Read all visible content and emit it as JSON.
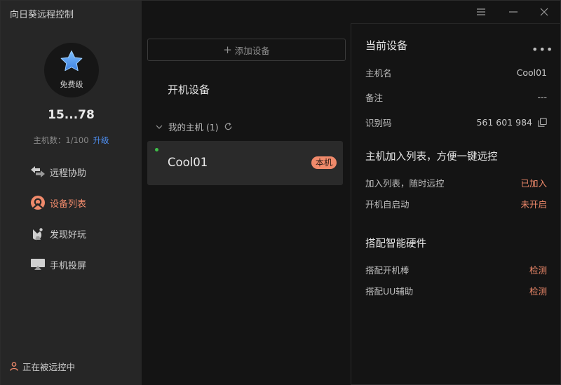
{
  "app": {
    "title": "向日葵远程控制"
  },
  "profile": {
    "tier": "免费级",
    "user_id": "15...78",
    "host_count_label": "主机数：1/100",
    "upgrade_label": "升级"
  },
  "nav": [
    {
      "label": "远程协助",
      "icon": "remote-assist-icon",
      "active": false
    },
    {
      "label": "设备列表",
      "icon": "device-list-icon",
      "active": true
    },
    {
      "label": "发现好玩",
      "icon": "discover-icon",
      "active": false
    },
    {
      "label": "手机投屏",
      "icon": "screen-cast-icon",
      "active": false
    }
  ],
  "status": {
    "label": "正在被远控中"
  },
  "middle": {
    "add_device": "添加设备",
    "section_title": "开机设备",
    "group_label": "我的主机 (1)",
    "device": {
      "name": "Cool01",
      "badge": "本机",
      "online": true
    }
  },
  "current_device": {
    "heading": "当前设备",
    "more": "•••",
    "rows": [
      {
        "label": "主机名",
        "value": "Cool01"
      },
      {
        "label": "备注",
        "value": "---"
      },
      {
        "label": "识别码",
        "value": "561 601 984"
      }
    ]
  },
  "host_list": {
    "heading": "主机加入列表，方便一键远控",
    "rows": [
      {
        "label": "加入列表，随时远控",
        "value": "已加入"
      },
      {
        "label": "开机自启动",
        "value": "未开启"
      }
    ]
  },
  "hardware": {
    "heading": "搭配智能硬件",
    "rows": [
      {
        "label": "搭配开机棒",
        "value": "检测"
      },
      {
        "label": "搭配UU辅助",
        "value": "检测"
      }
    ]
  },
  "colors": {
    "accent": "#f08a6b",
    "link": "#4e8ff2",
    "online": "#3fbf4a",
    "sidebar_bg": "#262626",
    "main_bg": "#141414"
  }
}
